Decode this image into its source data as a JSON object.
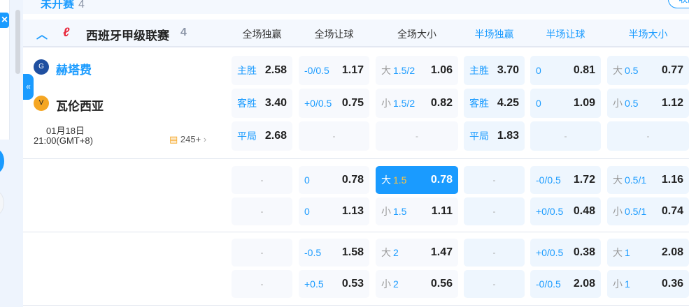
{
  "status": {
    "label": "未开赛",
    "count": "4",
    "collapse_label": "收起"
  },
  "league": {
    "name": "西班牙甲级联赛",
    "count": "4",
    "logo": "laliga-logo"
  },
  "columns": [
    "全场独赢",
    "全场让球",
    "全场大小",
    "半场独赢",
    "半场让球",
    "半场大小"
  ],
  "match": {
    "home": "赫塔费",
    "away": "瓦伦西亚",
    "date": "01月18日",
    "time": "21:00(GMT+8)",
    "markets": "245+"
  },
  "rows": [
    [
      [
        {
          "lbl": "主胜",
          "val": "2.58"
        },
        {
          "lbl": "-0/0.5",
          "val": "1.17"
        },
        {
          "pre": "大",
          "lbl": "1.5/2",
          "val": "1.06"
        },
        {
          "lbl": "主胜",
          "val": "3.70"
        },
        {
          "lbl": "0",
          "val": "0.81"
        },
        {
          "pre": "大",
          "lbl": "0.5",
          "val": "0.77"
        }
      ],
      [
        {
          "lbl": "客胜",
          "val": "3.40"
        },
        {
          "lbl": "+0/0.5",
          "val": "0.75"
        },
        {
          "pre": "小",
          "lbl": "1.5/2",
          "val": "0.82"
        },
        {
          "lbl": "客胜",
          "val": "4.25"
        },
        {
          "lbl": "0",
          "val": "1.09"
        },
        {
          "pre": "小",
          "lbl": "0.5",
          "val": "1.12"
        }
      ],
      [
        {
          "lbl": "平局",
          "val": "2.68"
        },
        {
          "dash": "-"
        },
        {
          "dash": "-"
        },
        {
          "lbl": "平局",
          "val": "1.83"
        },
        {
          "dash": "-"
        },
        {
          "dash": "-"
        }
      ]
    ],
    [
      [
        {
          "dash": "-"
        },
        {
          "lbl": "0",
          "val": "0.78"
        },
        {
          "pre": "大",
          "lbl": "1.5",
          "val": "0.78",
          "selected": true
        },
        {
          "dash": "-"
        },
        {
          "lbl": "-0/0.5",
          "val": "1.72"
        },
        {
          "pre": "大",
          "lbl": "0.5/1",
          "val": "1.16"
        }
      ],
      [
        {
          "dash": "-"
        },
        {
          "lbl": "0",
          "val": "1.13"
        },
        {
          "pre": "小",
          "lbl": "1.5",
          "val": "1.11"
        },
        {
          "dash": "-"
        },
        {
          "lbl": "+0/0.5",
          "val": "0.48"
        },
        {
          "pre": "小",
          "lbl": "0.5/1",
          "val": "0.74"
        }
      ]
    ],
    [
      [
        {
          "dash": "-"
        },
        {
          "lbl": "-0.5",
          "val": "1.58"
        },
        {
          "pre": "大",
          "lbl": "2",
          "val": "1.47"
        },
        {
          "dash": "-"
        },
        {
          "lbl": "+0/0.5",
          "val": "0.38"
        },
        {
          "pre": "大",
          "lbl": "1",
          "val": "2.08"
        }
      ],
      [
        {
          "dash": "-"
        },
        {
          "lbl": "+0.5",
          "val": "0.53"
        },
        {
          "pre": "小",
          "lbl": "2",
          "val": "0.56"
        },
        {
          "dash": "-"
        },
        {
          "lbl": "-0/0.5",
          "val": "2.08"
        },
        {
          "pre": "小",
          "lbl": "1",
          "val": "0.36"
        }
      ]
    ]
  ],
  "colors": {
    "accent": "#1a9bff",
    "selected_line": "#ffc53d"
  }
}
